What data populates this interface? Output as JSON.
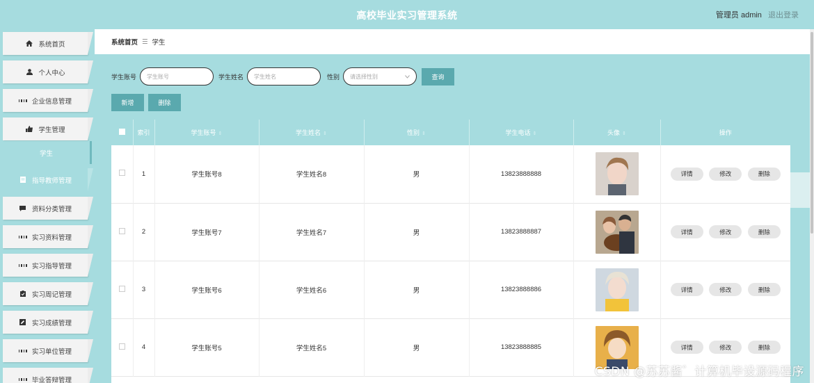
{
  "app": {
    "title": "高校毕业实习管理系统"
  },
  "header": {
    "user_label": "管理员 admin",
    "logout_label": "退出登录"
  },
  "sidebar": {
    "items": [
      {
        "label": "系统首页",
        "icon": "home-icon"
      },
      {
        "label": "个人中心",
        "icon": "user-icon"
      },
      {
        "label": "企业信息管理",
        "icon": "grid-icon"
      },
      {
        "label": "学生管理",
        "icon": "thumb-icon"
      },
      {
        "label": "学生",
        "icon": ""
      },
      {
        "label": "指导教师管理",
        "icon": "doc-icon"
      },
      {
        "label": "资料分类管理",
        "icon": "chat-icon"
      },
      {
        "label": "实习资料管理",
        "icon": "grid-icon"
      },
      {
        "label": "实习指导管理",
        "icon": "grid-icon"
      },
      {
        "label": "实习周记管理",
        "icon": "clipboard-icon"
      },
      {
        "label": "实习成绩管理",
        "icon": "edit-icon"
      },
      {
        "label": "实习单位管理",
        "icon": "grid-icon"
      },
      {
        "label": "毕业答辩管理",
        "icon": "grid-icon"
      }
    ]
  },
  "breadcrumb": {
    "home": "系统首页",
    "separator": "☰",
    "current": "学生"
  },
  "search": {
    "account_label": "学生账号",
    "account_placeholder": "学生账号",
    "name_label": "学生姓名",
    "name_placeholder": "学生姓名",
    "gender_label": "性别",
    "gender_placeholder": "请选择性别",
    "query_button": "查询"
  },
  "actions": {
    "add": "新增",
    "delete": "删除"
  },
  "table": {
    "headers": [
      "索引",
      "学生账号",
      "学生姓名",
      "性别",
      "学生电话",
      "头像",
      "操作"
    ],
    "rows": [
      {
        "index": "1",
        "account": "学生账号8",
        "name": "学生姓名8",
        "gender": "男",
        "phone": "13823888888"
      },
      {
        "index": "2",
        "account": "学生账号7",
        "name": "学生姓名7",
        "gender": "男",
        "phone": "13823888887"
      },
      {
        "index": "3",
        "account": "学生账号6",
        "name": "学生姓名6",
        "gender": "男",
        "phone": "13823888886"
      },
      {
        "index": "4",
        "account": "学生账号5",
        "name": "学生姓名5",
        "gender": "男",
        "phone": "13823888885"
      }
    ],
    "row_actions": {
      "detail": "详情",
      "edit": "修改",
      "delete": "删除"
    }
  },
  "watermark": "CSDN @苏苏酱゛计算机毕设源码程序",
  "colors": {
    "accent": "#a6dcdf",
    "button": "#5aa9ae"
  }
}
